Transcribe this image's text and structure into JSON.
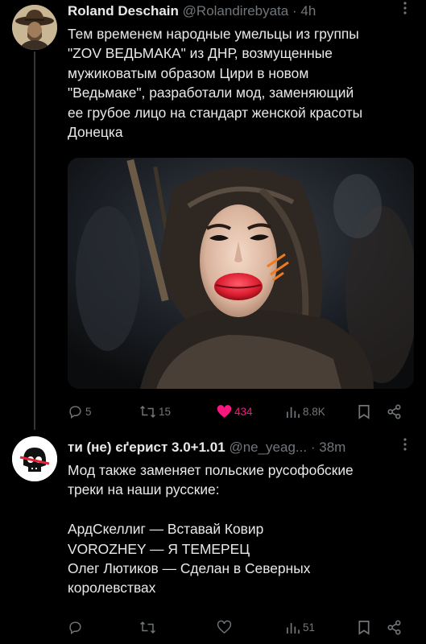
{
  "tweet1": {
    "author_name": "Roland Deschain",
    "author_handle": "@Rolandirebyata",
    "separator": "·",
    "time": "4h",
    "text_lines": [
      "Тем временем народные умельцы из группы",
      "\"ZOV ВЕДЬМАКА\" из ДНР, возмущенные",
      "мужиковатым образом Цири в новом",
      "\"Ведьмаке\", разработали мод, заменяющий",
      "ее грубое лицо на стандарт женской красоты",
      "Донецка"
    ],
    "stats": {
      "replies": "5",
      "retweets": "15",
      "likes": "434",
      "views": "8.8K"
    }
  },
  "tweet2": {
    "author_name": "ти (не) єґерист 3.0+1.01",
    "author_handle": "@ne_yeag...",
    "separator": "·",
    "time": "38m",
    "text_lines_top": [
      "Мод также заменяет польские русофобские",
      "треки на наши русские:"
    ],
    "text_lines_bottom": [
      "АрдСкеллиг — Вставай Ковир",
      "VOROZHEY — Я ТЕМЕРЕЦ",
      "Олег Лютиков — Сделан в Северных",
      "королевствах"
    ],
    "stats": {
      "views": "51"
    }
  },
  "colors": {
    "background": "#000000",
    "text": "#e7e9ea",
    "muted": "#71767b",
    "like": "#f91880",
    "divider": "#2f3336"
  }
}
